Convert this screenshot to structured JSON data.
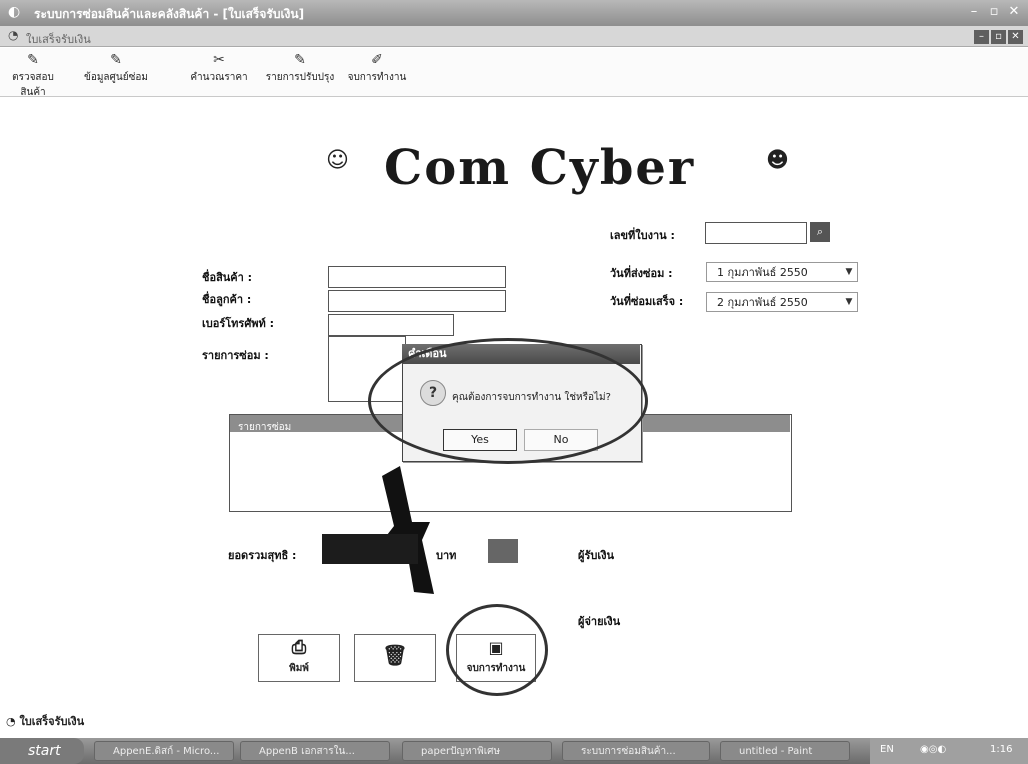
{
  "window": {
    "title": "ระบบการซ่อมสินค้าและคลังสินค้า - [ใบเสร็จรับเงิน]",
    "mdi_title": "ใบเสร็จรับเงิน"
  },
  "toolbar": {
    "items": [
      {
        "label": "ตรวจสอบสินค้า"
      },
      {
        "label": "ข้อมูลศูนย์ซ่อม"
      },
      {
        "label": "คำนวณราคา"
      },
      {
        "label": "รายการปรับปรุง"
      },
      {
        "label": "จบการทำงาน"
      }
    ]
  },
  "logo": {
    "text": "Com Cyber"
  },
  "form": {
    "job_no_label": "เลขที่ใบงาน :",
    "product_name_label": "ชื่อสินค้า :",
    "customer_name_label": "ชื่อลูกค้า :",
    "phone_label": "เบอร์โทรศัพท์ :",
    "repair_list_label": "รายการซ่อม :",
    "send_date_label": "วันที่ส่งซ่อม :",
    "send_date_value": "1 กุมภาพันธ์  2550",
    "done_date_label": "วันที่ซ่อมเสร็จ :",
    "done_date_value": "2 กุมภาพันธ์  2550",
    "panel_header": "รายการซ่อม",
    "total_label": "ยอดรวมสุทธิ :",
    "baht_label": "บาท",
    "receiver_label": "ผู้รับเงิน",
    "payer_label": "ผู้จ่ายเงิน"
  },
  "dialog": {
    "title": "คำเตือน",
    "message": "คุณต้องการจบการทำงาน ใช่หรือไม่?",
    "yes": "Yes",
    "no": "No"
  },
  "actions": {
    "print": "พิมพ์",
    "exit": "จบการทำงาน"
  },
  "status_bar": {
    "text": "ใบเสร็จรับเงิน"
  },
  "taskbar": {
    "start": "start",
    "tasks": [
      "AppenE.ดิสก์ - Micro...",
      "AppenB เอกสารใน...",
      "paperปัญหาพิเศษ",
      "ระบบการซ่อมสินค้า...",
      "untitled - Paint"
    ],
    "lang": "EN",
    "clock": "1:16"
  },
  "colors": {
    "dark_fill": "#1c1c1c",
    "titlebar": "#8e8e8e"
  }
}
